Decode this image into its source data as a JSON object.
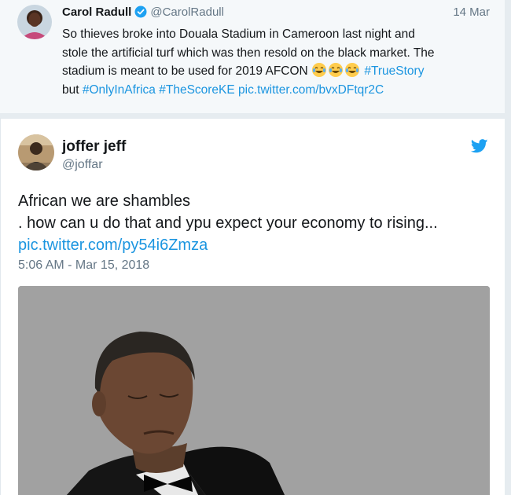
{
  "parent_tweet": {
    "author_name": "Carol Radull",
    "author_handle": "@CarolRadull",
    "date": "14 Mar",
    "text_line1": "So thieves broke into Douala Stadium in Cameroon last night and",
    "text_line2": "stole the artificial turf which was then resold on the black market. The",
    "text_line3_prefix": "stadium is meant to be used for 2019 AFCON",
    "hashtag_truestory": "#TrueStory",
    "text_line4_prefix": "but",
    "hashtag_onlyinafrica": "#OnlyInAfrica",
    "hashtag_thescoreke": "#TheScoreKE",
    "pic_link": "pic.twitter.com/bvxDFtqr2C",
    "emoji_names": [
      "laughing-tears-emoji",
      "laughing-tears-emoji",
      "laughing-tears-emoji"
    ]
  },
  "tweet": {
    "author_name": "joffer jeff",
    "author_handle": "@joffar",
    "text_line1": "African we are shambles",
    "text_line2": ". how can u do that and ypu expect your economy to rising...",
    "pic_link": "pic.twitter.com/py54i6Zmza",
    "timestamp": "5:06 AM - Mar 15, 2018"
  },
  "colors": {
    "link": "#1b95e0",
    "secondary_text": "#657786",
    "parent_background": "#f5f8fa",
    "page_background": "#e6ecf0",
    "verified_badge": "#1da1f2",
    "media_background": "#a0a0a0"
  },
  "icons": {
    "verified": "verified-badge-icon",
    "twitter": "twitter-bird-icon"
  }
}
